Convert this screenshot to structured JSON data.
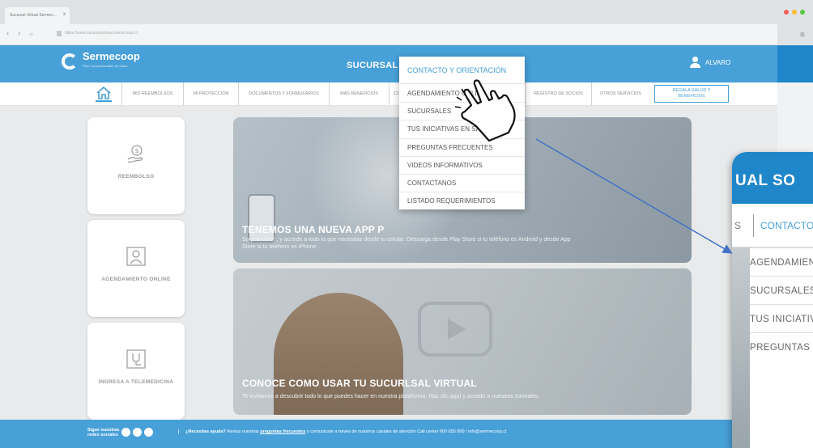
{
  "browser": {
    "tab_title": "Sucursal Virtual Sermec...",
    "url": "https://www.sucursalvirtual.sermecoop.cl",
    "nav_back": "‹",
    "nav_forward": "›",
    "nav_reload": "○",
    "tab_close": "x",
    "menu_icon": "≡"
  },
  "header": {
    "brand": "Sermecoop",
    "brand_sub": "Plan Complementario de Salud",
    "title": "SUCURSAL",
    "user": "ALVARO",
    "bg_color": "#48a0d8"
  },
  "menubar": {
    "items": [
      "MIS REEMBOLSOS",
      "MI PROTECCIÓN",
      "DOCUMENTOS Y FORMULARIOS",
      "MÁS BENEFICIOS",
      "CO",
      "REGISTRO DE SOCIOS",
      "OTROS SERVICIOS"
    ],
    "regala": "REGALA SALUD Y BENEFICIOS"
  },
  "cards": [
    {
      "label": "REEMBOLSO",
      "icon": "money-hand-icon"
    },
    {
      "label": "AGENDAMIENTO ONLINE",
      "icon": "doctor-screen-icon"
    },
    {
      "label": "INGRESA A TELEMEDICINA",
      "icon": "stethoscope-screen-icon"
    }
  ],
  "banners": [
    {
      "title": "TENEMOS UNA NUEVA APP P",
      "text": "Sorprendete! , y accede a todo lo que necesitas desde tu celular. Descarga desde Play Store si tu teléfono es Android y desde App Store si tu teléfono es iPhone."
    },
    {
      "title": "CONOCE COMO USAR TU SUCURLSAL VIRTUAL",
      "text": "Te invitamos a descubrir todo lo que puedes hacer en nuestra plataforma. Haz clic aquí y accede a nuestros tutoriales."
    }
  ],
  "dropdown": {
    "header": "CONTACTO Y ORIENTACIÓN",
    "items": [
      "AGENDAMIENTO ONLINE",
      "SUCURSALES",
      "TUS INICIATIVAS EN SALUD",
      "PREGUNTAS FRECUENTES",
      "VIDEOS INFORMATIVOS",
      "CONTACTANOS",
      "LISTADO REQUERIMIENTOS"
    ]
  },
  "footer": {
    "social_label": "Sigue nuestras redes sociales",
    "help_bold": "¿Necesitas ayuda?",
    "help_pre": "Revisa nuestras",
    "help_link": "preguntas frecuentes",
    "help_post": "o comunícate a través de nuestros canales de atención Call center 600 655 800 / info@sermecoop.cl"
  },
  "zoom": {
    "header": "UAL SO",
    "s": "S",
    "contact": "CONTACTO",
    "items": [
      "AGENDAMIENTO",
      "SUCURSALES",
      "TUS INICIATIVAS",
      "PREGUNTAS"
    ]
  }
}
